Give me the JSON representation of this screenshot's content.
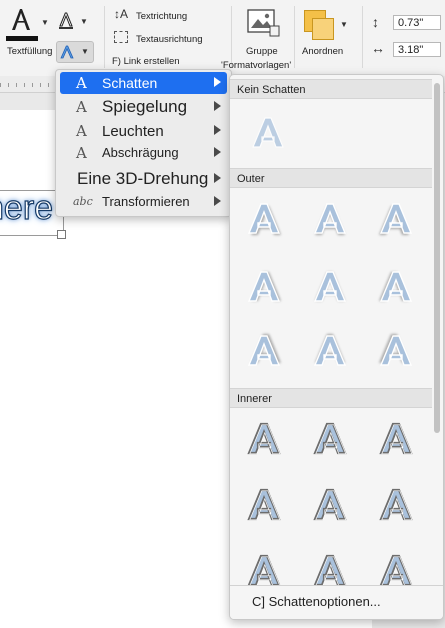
{
  "ribbon": {
    "textfill_label": "Textfüllung",
    "text_direction_label": "Textrichtung",
    "text_alignment_label": "Textausrichtung",
    "create_link_label": "F) Link erstellen",
    "group_label": "Gruppe",
    "format_templates_label": "'Formatvorlagen'",
    "arrange_label": "Anordnen",
    "height_value": "0.73\"",
    "width_value": "3.18\""
  },
  "document": {
    "visible_text": "nere"
  },
  "effects_menu": {
    "items": [
      {
        "label": "Schatten",
        "icon": "shadow-a-icon",
        "selected": true
      },
      {
        "label": "Spiegelung",
        "icon": "reflection-a-icon"
      },
      {
        "label": "Leuchten",
        "icon": "glow-a-icon"
      },
      {
        "label": "Abschrägung",
        "icon": "bevel-a-icon"
      },
      {
        "label": "Eine 3D-Drehung",
        "icon": "3d-rotation-a-icon"
      },
      {
        "label": "Transformieren",
        "icon": "transform-abc-icon"
      }
    ]
  },
  "shadow_gallery": {
    "section_none": "Kein Schatten",
    "section_outer": "Outer",
    "section_inner": "Innerer",
    "options_button": "C] Schattenoptionen..."
  },
  "colors": {
    "accent": "#1e6ff0",
    "letter_fill": "#a9c1dc",
    "letter_outline": "#ffffff",
    "shadow": "#6d6d6d"
  }
}
